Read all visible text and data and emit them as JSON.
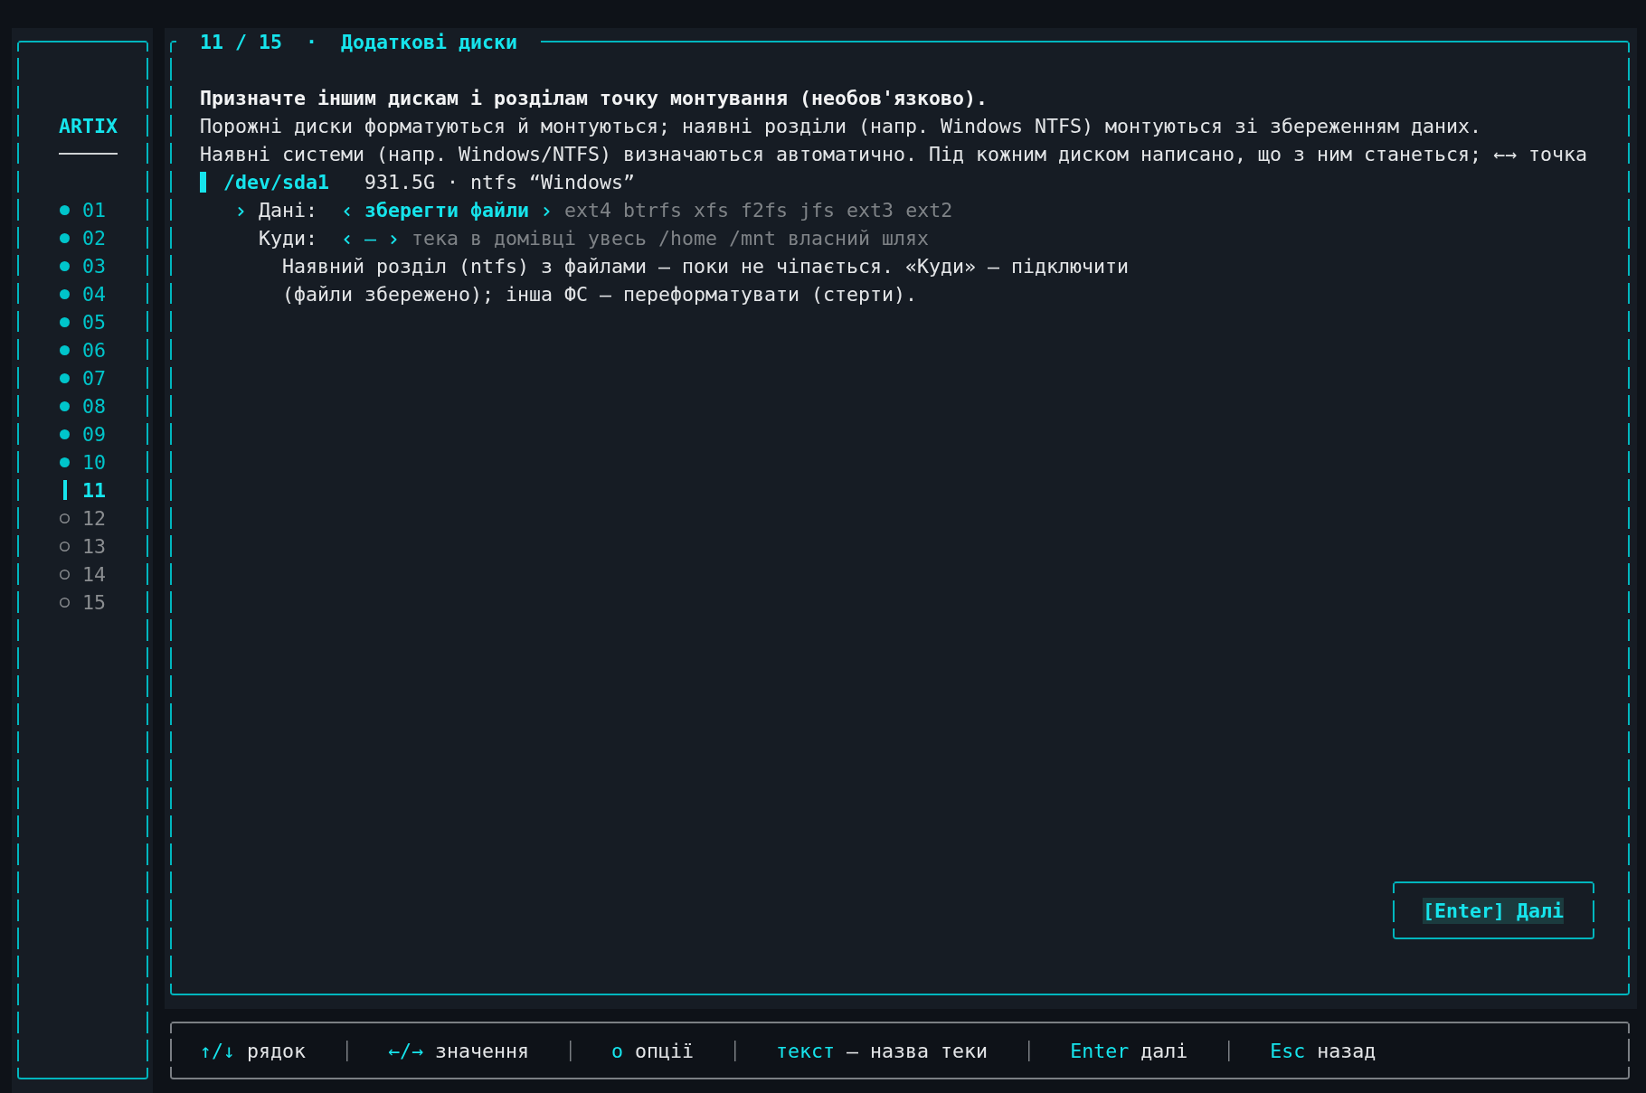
{
  "sidebar": {
    "brand": "ARTIX",
    "steps": [
      {
        "label": "01",
        "done": true,
        "selected": false
      },
      {
        "label": "02",
        "done": true,
        "selected": false
      },
      {
        "label": "03",
        "done": true,
        "selected": false
      },
      {
        "label": "04",
        "done": true,
        "selected": false
      },
      {
        "label": "05",
        "done": true,
        "selected": false
      },
      {
        "label": "06",
        "done": true,
        "selected": false
      },
      {
        "label": "07",
        "done": true,
        "selected": false
      },
      {
        "label": "08",
        "done": true,
        "selected": false
      },
      {
        "label": "09",
        "done": true,
        "selected": false
      },
      {
        "label": "10",
        "done": true,
        "selected": false
      },
      {
        "label": "11",
        "done": false,
        "selected": true
      },
      {
        "label": "12",
        "done": false,
        "selected": false
      },
      {
        "label": "13",
        "done": false,
        "selected": false
      },
      {
        "label": "14",
        "done": false,
        "selected": false
      },
      {
        "label": "15",
        "done": false,
        "selected": false
      }
    ]
  },
  "panel": {
    "title": "11 / 15  ·  Додаткові диски",
    "heading": "Призначте іншим дискам і розділам точку монтування (необов'язково).",
    "description": [
      "Порожні диски форматуються й монтуються; наявні розділи (напр. Windows NTFS) монтуються зі збереженням даних.",
      "Наявні системи (напр. Windows/NTFS) визначаються автоматично. Під кожним диском написано, що з ним станеться; ←→ точка"
    ],
    "disks": [
      {
        "device": "/dev/sda1",
        "info": "931.5G · ntfs “Windows”",
        "selected": true,
        "fields": [
          {
            "label": "Дані:",
            "focused": true,
            "options": [
              {
                "text": "зберегти файли",
                "selected": true
              },
              {
                "text": "ext4",
                "selected": false
              },
              {
                "text": "btrfs",
                "selected": false
              },
              {
                "text": "xfs",
                "selected": false
              },
              {
                "text": "f2fs",
                "selected": false
              },
              {
                "text": "jfs",
                "selected": false
              },
              {
                "text": "ext3",
                "selected": false
              },
              {
                "text": "ext2",
                "selected": false
              }
            ]
          },
          {
            "label": "Куди:",
            "focused": false,
            "options": [
              {
                "text": "—",
                "selected": true
              },
              {
                "text": "тека в домівці",
                "selected": false
              },
              {
                "text": "увесь /home",
                "selected": false
              },
              {
                "text": "/mnt",
                "selected": false
              },
              {
                "text": "власний шлях",
                "selected": false
              }
            ]
          }
        ],
        "note": "Наявний розділ (ntfs) з файлами — поки не чіпається. «Куди» — підключити (файли збережено); інша ФС — переформатувати (стерти)."
      }
    ],
    "next_button": "[Enter] Далі"
  },
  "footer": {
    "hints": [
      {
        "key": "↑/↓",
        "label": "рядок"
      },
      {
        "key": "←/→",
        "label": "значення"
      },
      {
        "key": "o",
        "label": "опції"
      },
      {
        "key": "текст",
        "label": "— назва теки"
      },
      {
        "key": "Enter",
        "label": "далі"
      },
      {
        "key": "Esc",
        "label": "назад"
      }
    ]
  }
}
